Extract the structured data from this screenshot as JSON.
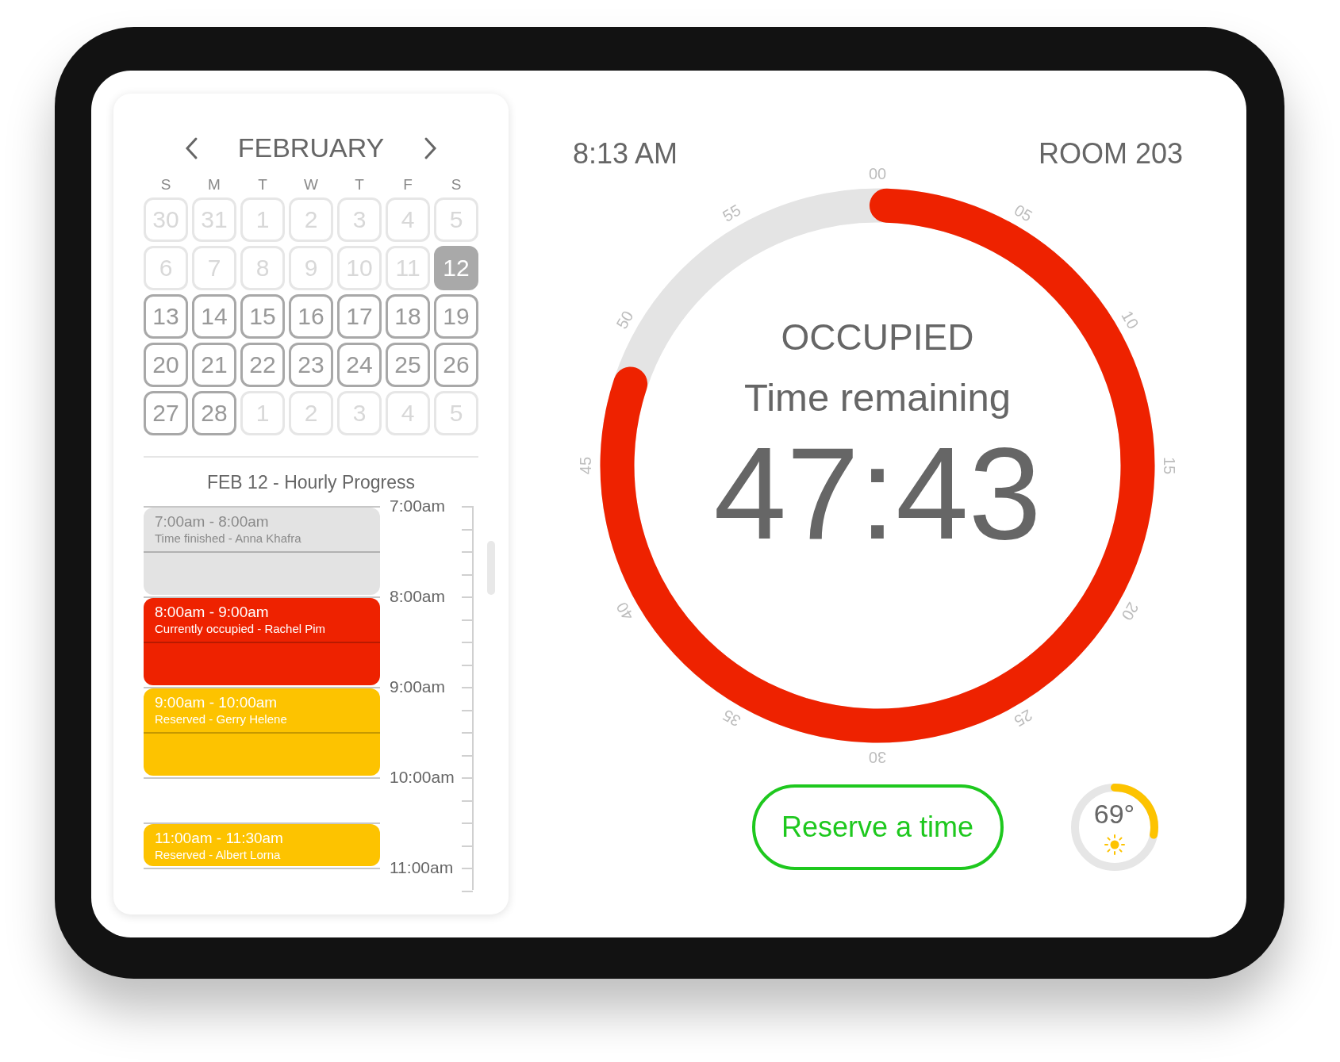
{
  "calendar": {
    "month": "FEBRUARY",
    "weekdays": [
      "S",
      "M",
      "T",
      "W",
      "T",
      "F",
      "S"
    ],
    "days": [
      {
        "label": "30",
        "muted": true,
        "selected": false
      },
      {
        "label": "31",
        "muted": true,
        "selected": false
      },
      {
        "label": "1",
        "muted": true,
        "selected": false
      },
      {
        "label": "2",
        "muted": true,
        "selected": false
      },
      {
        "label": "3",
        "muted": true,
        "selected": false
      },
      {
        "label": "4",
        "muted": true,
        "selected": false
      },
      {
        "label": "5",
        "muted": true,
        "selected": false
      },
      {
        "label": "6",
        "muted": true,
        "selected": false
      },
      {
        "label": "7",
        "muted": true,
        "selected": false
      },
      {
        "label": "8",
        "muted": true,
        "selected": false
      },
      {
        "label": "9",
        "muted": true,
        "selected": false
      },
      {
        "label": "10",
        "muted": true,
        "selected": false
      },
      {
        "label": "11",
        "muted": true,
        "selected": false
      },
      {
        "label": "12",
        "muted": false,
        "selected": true
      },
      {
        "label": "13",
        "muted": false,
        "selected": false
      },
      {
        "label": "14",
        "muted": false,
        "selected": false
      },
      {
        "label": "15",
        "muted": false,
        "selected": false
      },
      {
        "label": "16",
        "muted": false,
        "selected": false
      },
      {
        "label": "17",
        "muted": false,
        "selected": false
      },
      {
        "label": "18",
        "muted": false,
        "selected": false
      },
      {
        "label": "19",
        "muted": false,
        "selected": false
      },
      {
        "label": "20",
        "muted": false,
        "selected": false
      },
      {
        "label": "21",
        "muted": false,
        "selected": false
      },
      {
        "label": "22",
        "muted": false,
        "selected": false
      },
      {
        "label": "23",
        "muted": false,
        "selected": false
      },
      {
        "label": "24",
        "muted": false,
        "selected": false
      },
      {
        "label": "25",
        "muted": false,
        "selected": false
      },
      {
        "label": "26",
        "muted": false,
        "selected": false
      },
      {
        "label": "27",
        "muted": false,
        "selected": false
      },
      {
        "label": "28",
        "muted": false,
        "selected": false
      },
      {
        "label": "1",
        "muted": true,
        "selected": false
      },
      {
        "label": "2",
        "muted": true,
        "selected": false
      },
      {
        "label": "3",
        "muted": true,
        "selected": false
      },
      {
        "label": "4",
        "muted": true,
        "selected": false
      },
      {
        "label": "5",
        "muted": true,
        "selected": false
      }
    ]
  },
  "schedule": {
    "title": "FEB 12 - Hourly Progress",
    "hours": [
      "7:00am",
      "8:00am",
      "9:00am",
      "10:00am",
      "11:00am"
    ],
    "events": [
      {
        "color": "#e3e3e3",
        "time": "7:00am - 8:00am",
        "detail": "Time finished - Anna Khafra"
      },
      {
        "color": "#ee2200",
        "time": "8:00am - 9:00am",
        "detail": "Currently occupied - Rachel Pim"
      },
      {
        "color": "#fdc300",
        "time": "9:00am - 10:00am",
        "detail": "Reserved - Gerry Helene"
      },
      {
        "color": "#fdc300",
        "time": "11:00am - 11:30am",
        "detail": "Reserved - Albert Lorna"
      }
    ]
  },
  "header": {
    "time": "8:13 AM",
    "room": "ROOM 203"
  },
  "timer": {
    "status": "OCCUPIED",
    "caption": "Time remaining",
    "remaining": "47:43",
    "level": 0.795,
    "minute_labels": [
      "00",
      "05",
      "10",
      "15",
      "20",
      "25",
      "30",
      "35",
      "40",
      "45",
      "50",
      "55"
    ]
  },
  "reserve_button": "Reserve a time",
  "weather": {
    "temperature": "69°",
    "level": 0.28
  }
}
